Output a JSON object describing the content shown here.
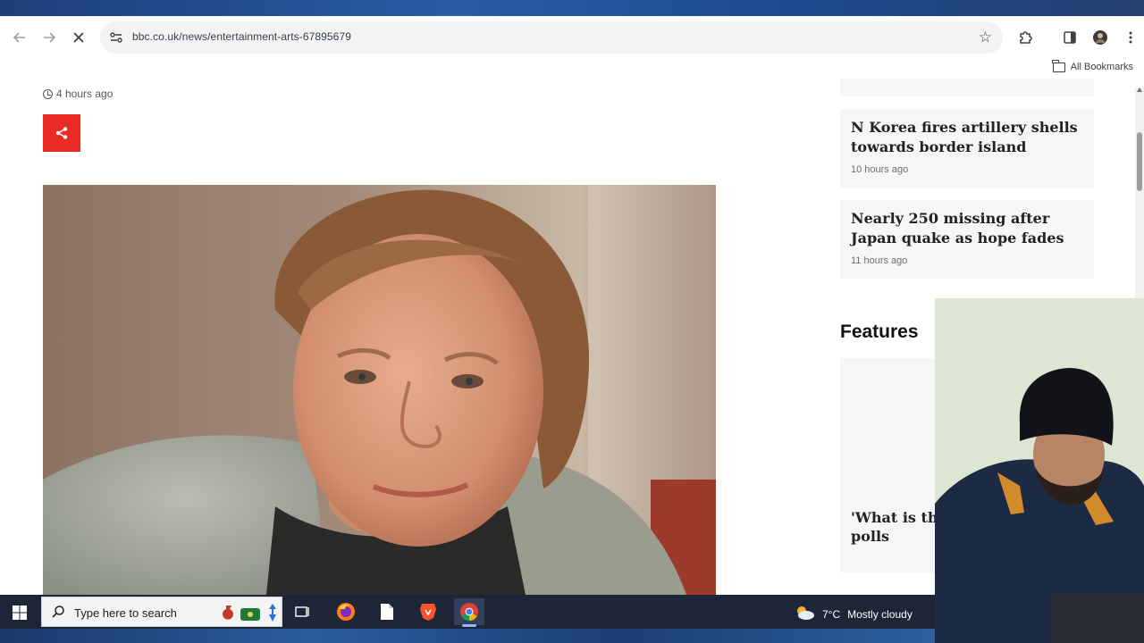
{
  "browser": {
    "url": "bbc.co.uk/news/entertainment-arts-67895679",
    "bookmarks_label": "All Bookmarks"
  },
  "article": {
    "timestamp": "4 hours ago"
  },
  "sidebar": {
    "stories": [
      {
        "headline": "N Korea fires artillery shells towards border island",
        "time": "10 hours ago"
      },
      {
        "headline": "Nearly 250 missing after Japan quake as hope fades",
        "time": "11 hours ago"
      }
    ],
    "features_heading": "Features",
    "feature_title": "'What is th… disillusion… polls"
  },
  "taskbar": {
    "search_placeholder": "Type here to search",
    "weather_temp": "7°C",
    "weather_desc": "Mostly cloudy"
  },
  "colors": {
    "bbc_red": "#e82b26",
    "taskbar_bg": "#1d2536"
  },
  "icons": [
    "back-icon",
    "forward-icon",
    "stop-icon",
    "site-settings-icon",
    "star-icon",
    "extensions-icon",
    "side-panel-icon",
    "profile-icon",
    "menu-icon",
    "folder-icon",
    "clock-icon",
    "share-icon",
    "windows-start-icon",
    "search-icon",
    "task-view-icon",
    "firefox-icon",
    "file-icon",
    "brave-icon",
    "chrome-icon",
    "weather-icon"
  ]
}
